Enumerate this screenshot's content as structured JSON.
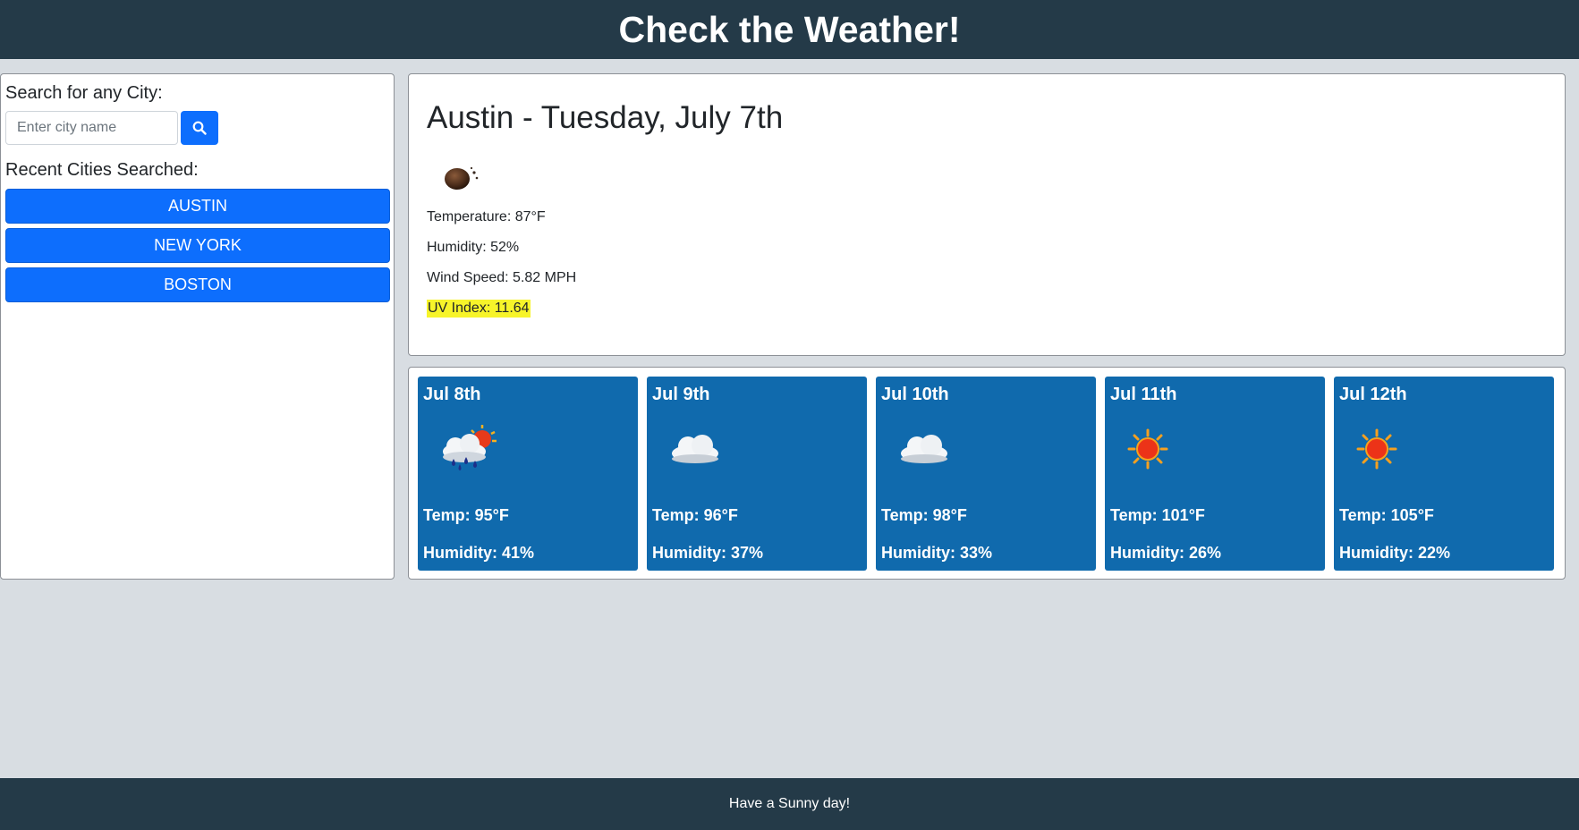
{
  "header": {
    "title": "Check the Weather!"
  },
  "sidebar": {
    "search_label": "Search for any City:",
    "search_placeholder": "Enter city name",
    "search_icon": "search-icon",
    "recent_label": "Recent Cities Searched:",
    "cities": [
      "AUSTIN",
      "NEW YORK",
      "BOSTON"
    ]
  },
  "current": {
    "title": "Austin - Tuesday, July 7th",
    "icon": "clear-night-icon",
    "temperature": "Temperature: 87°F",
    "humidity": "Humidity: 52%",
    "wind": "Wind Speed: 5.82 MPH",
    "uv": "UV Index: 11.64"
  },
  "forecast": [
    {
      "date": "Jul 8th",
      "icon": "rain-sun-icon",
      "temp": "Temp: 95°F",
      "humidity": "Humidity: 41%"
    },
    {
      "date": "Jul 9th",
      "icon": "cloud-icon",
      "temp": "Temp: 96°F",
      "humidity": "Humidity: 37%"
    },
    {
      "date": "Jul 10th",
      "icon": "cloud-icon",
      "temp": "Temp: 98°F",
      "humidity": "Humidity: 33%"
    },
    {
      "date": "Jul 11th",
      "icon": "sun-icon",
      "temp": "Temp: 101°F",
      "humidity": "Humidity: 26%"
    },
    {
      "date": "Jul 12th",
      "icon": "sun-icon",
      "temp": "Temp: 105°F",
      "humidity": "Humidity: 22%"
    }
  ],
  "footer": {
    "text": "Have a Sunny day!"
  },
  "colors": {
    "header_bg": "#243a48",
    "page_bg": "#d8dde2",
    "button_blue": "#0d6efd",
    "card_blue": "#106aad",
    "uv_highlight": "#f7f42a"
  }
}
